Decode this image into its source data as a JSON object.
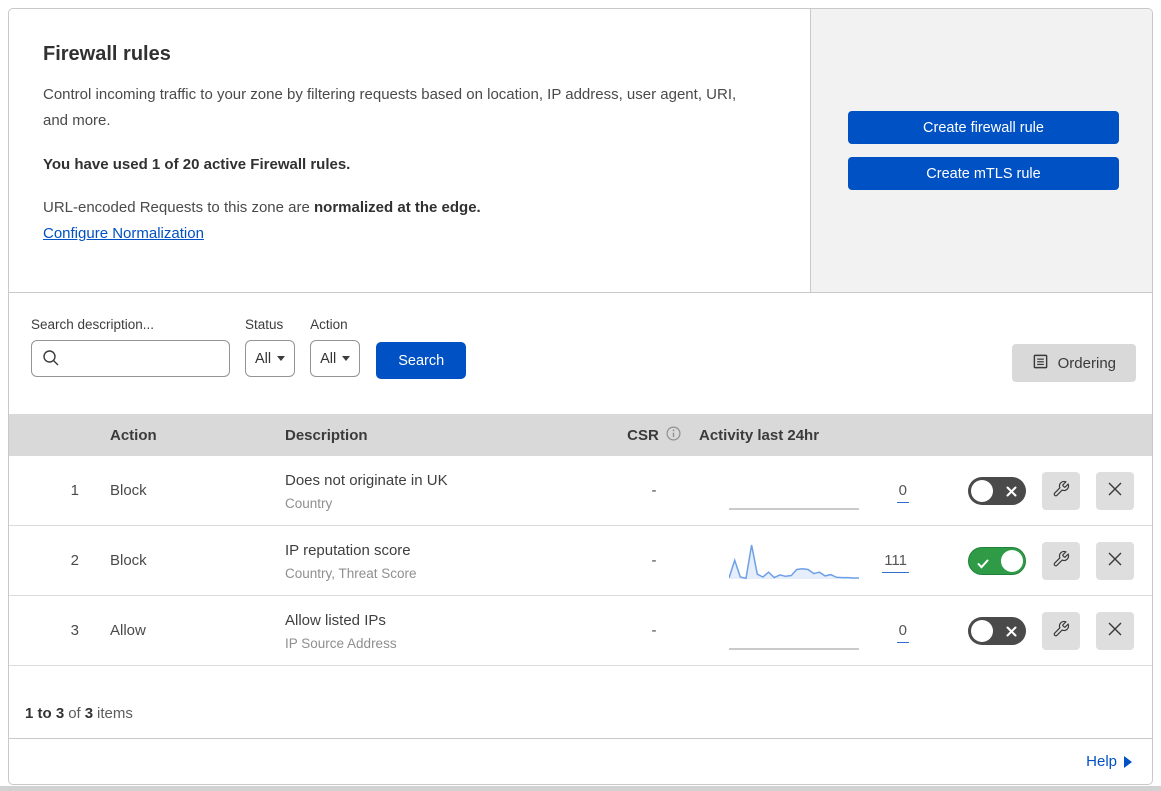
{
  "header": {
    "title": "Firewall rules",
    "description": "Control incoming traffic to your zone by filtering requests based on location, IP address, user agent, URI, and more.",
    "usage": "You have used 1 of 20 active Firewall rules.",
    "normalization_text": "URL-encoded Requests to this zone are ",
    "normalization_bold": "normalized at the edge.",
    "normalization_link": "Configure Normalization"
  },
  "actions_panel": {
    "create_firewall_label": "Create firewall rule",
    "create_mtls_label": "Create mTLS rule"
  },
  "filters": {
    "search_label": "Search description...",
    "search_value": "",
    "status_label": "Status",
    "status_value": "All",
    "action_label": "Action",
    "action_value": "All",
    "search_button_label": "Search",
    "ordering_button_label": "Ordering"
  },
  "table": {
    "columns": {
      "action": "Action",
      "description": "Description",
      "csr": "CSR",
      "activity": "Activity last 24hr"
    },
    "rows": [
      {
        "number": "1",
        "action": "Block",
        "description": "Does not originate in UK",
        "fields": "Country",
        "csr": "-",
        "activity_count": "0",
        "activity_values": [
          0,
          0,
          0,
          0,
          0,
          0,
          0,
          0,
          0,
          0,
          0,
          0
        ],
        "enabled": false
      },
      {
        "number": "2",
        "action": "Block",
        "description": "IP reputation score",
        "fields": "Country, Threat Score",
        "csr": "-",
        "activity_count": "111",
        "activity_values": [
          3,
          55,
          6,
          2,
          100,
          14,
          6,
          20,
          4,
          12,
          8,
          10,
          28,
          30,
          28,
          16,
          20,
          9,
          13,
          5,
          4,
          4,
          3,
          3
        ],
        "enabled": true
      },
      {
        "number": "3",
        "action": "Allow",
        "description": "Allow listed IPs",
        "fields": "IP Source Address",
        "csr": "-",
        "activity_count": "0",
        "activity_values": [
          0,
          0,
          0,
          0,
          0,
          0,
          0,
          0,
          0,
          0,
          0,
          0
        ],
        "enabled": false
      }
    ],
    "footer": {
      "range": "1 to 3",
      "of": "of",
      "total": "3",
      "items": "items"
    }
  },
  "help_label": "Help",
  "colors": {
    "accent_blue": "#0051c3",
    "toggle_on_green": "#2f9b47",
    "toggle_off_gray": "#4a4a4a",
    "sparkline_blue": "#6ea0e6",
    "sparkline_fill": "rgba(110,160,230,0.18)",
    "sparkline_flat": "#b9b9b9",
    "table_header_bg": "#d9d9d9",
    "panel_bg": "#f2f2f2"
  }
}
